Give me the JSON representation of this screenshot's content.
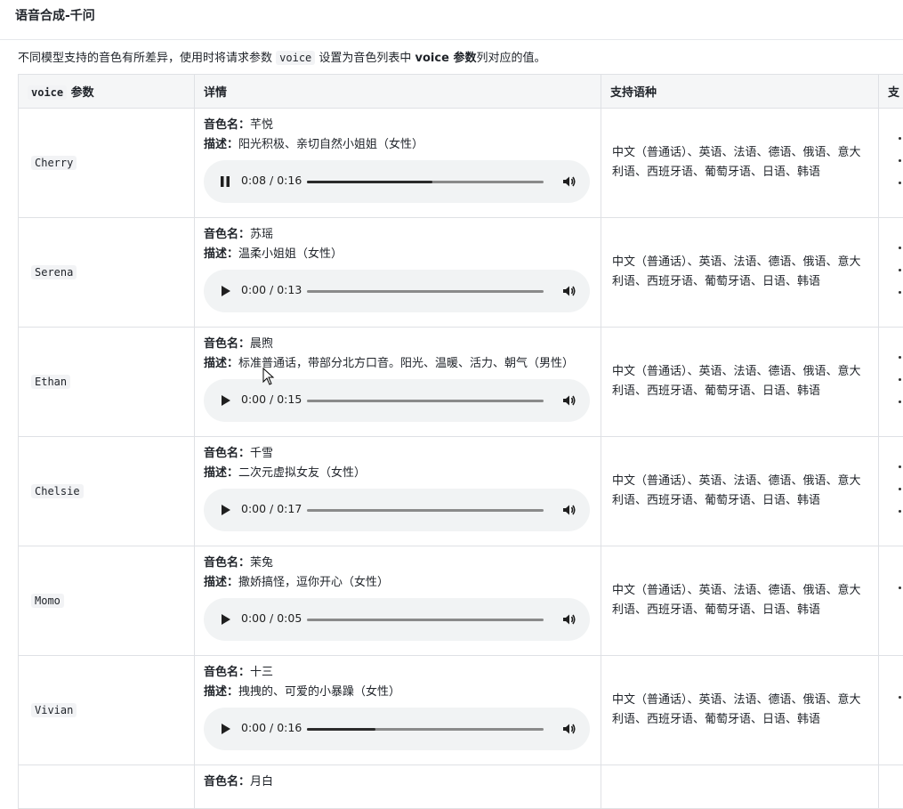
{
  "page": {
    "title": "语音合成-千问"
  },
  "intro": {
    "text1": "不同模型支持的音色有所差异，使用时将请求参数 ",
    "code1": "voice",
    "text2": " 设置为音色列表中 ",
    "bold1": "voice 参数",
    "text3": "列对应的值。"
  },
  "table": {
    "headers": {
      "voice_code": "voice",
      "voice_suffix": " 参数",
      "detail": "详情",
      "lang": "支持语种",
      "more": "支"
    },
    "name_label": "音色名：",
    "desc_label": "描述：",
    "rows": [
      {
        "voice": "Cherry",
        "name": "芊悦",
        "desc": "阳光积极、亲切自然小姐姐（女性）",
        "time": "0:08 / 0:16",
        "progress": 0.53,
        "playing": true,
        "lang": "中文（普通话）、英语、法语、德语、俄语、意大利语、西班牙语、葡萄牙语、日语、韩语"
      },
      {
        "voice": "Serena",
        "name": "苏瑶",
        "desc": "温柔小姐姐（女性）",
        "time": "0:00 / 0:13",
        "progress": 0,
        "playing": false,
        "lang": "中文（普通话）、英语、法语、德语、俄语、意大利语、西班牙语、葡萄牙语、日语、韩语"
      },
      {
        "voice": "Ethan",
        "name": "晨煦",
        "desc": "标准普通话，带部分北方口音。阳光、温暖、活力、朝气（男性）",
        "time": "0:00 / 0:15",
        "progress": 0,
        "playing": false,
        "lang": "中文（普通话）、英语、法语、德语、俄语、意大利语、西班牙语、葡萄牙语、日语、韩语"
      },
      {
        "voice": "Chelsie",
        "name": "千雪",
        "desc": "二次元虚拟女友（女性）",
        "time": "0:00 / 0:17",
        "progress": 0,
        "playing": false,
        "lang": "中文（普通话）、英语、法语、德语、俄语、意大利语、西班牙语、葡萄牙语、日语、韩语"
      },
      {
        "voice": "Momo",
        "name": "茉兔",
        "desc": "撒娇搞怪，逗你开心（女性）",
        "time": "0:00 / 0:05",
        "progress": 0,
        "playing": false,
        "lang": "中文（普通话）、英语、法语、德语、俄语、意大利语、西班牙语、葡萄牙语、日语、韩语"
      },
      {
        "voice": "Vivian",
        "name": "十三",
        "desc": "拽拽的、可爱的小暴躁（女性）",
        "time": "0:00 / 0:16",
        "progress": 0.29,
        "playing": false,
        "lang": "中文（普通话）、英语、法语、德语、俄语、意大利语、西班牙语、葡萄牙语、日语、韩语"
      }
    ],
    "partial_row": {
      "name": "月白"
    }
  }
}
